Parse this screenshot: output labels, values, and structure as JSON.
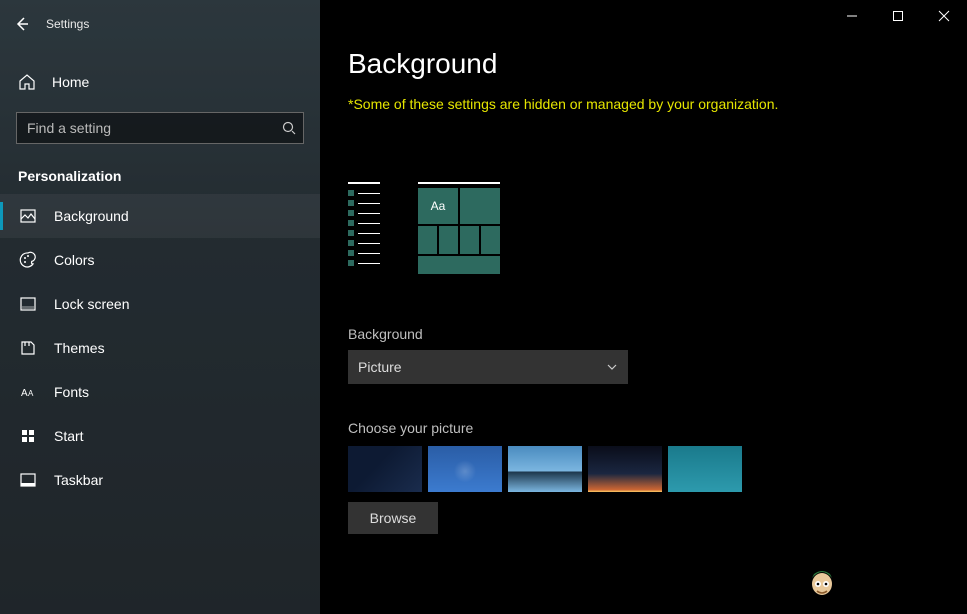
{
  "app_title": "Settings",
  "sidebar": {
    "home_label": "Home",
    "search_placeholder": "Find a setting",
    "section_title": "Personalization",
    "items": [
      {
        "label": "Background",
        "icon": "image-icon",
        "active": true
      },
      {
        "label": "Colors",
        "icon": "palette-icon",
        "active": false
      },
      {
        "label": "Lock screen",
        "icon": "lockscreen-icon",
        "active": false
      },
      {
        "label": "Themes",
        "icon": "themes-icon",
        "active": false
      },
      {
        "label": "Fonts",
        "icon": "fonts-icon",
        "active": false
      },
      {
        "label": "Start",
        "icon": "start-icon",
        "active": false
      },
      {
        "label": "Taskbar",
        "icon": "taskbar-icon",
        "active": false
      }
    ]
  },
  "content": {
    "page_title": "Background",
    "warning": "*Some of these settings are hidden or managed by your organization.",
    "preview_sample_text": "Aa",
    "bg_label": "Background",
    "bg_dropdown_value": "Picture",
    "choose_label": "Choose your picture",
    "browse_label": "Browse"
  },
  "colors": {
    "accent": "#2d6a5f",
    "warning_text": "#e6e600"
  }
}
